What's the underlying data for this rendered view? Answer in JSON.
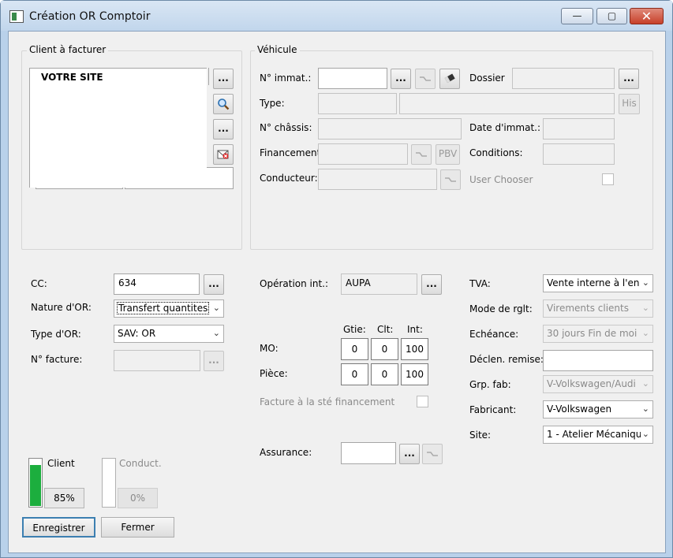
{
  "window": {
    "title": "Création OR Comptoir",
    "minimize": "—",
    "maximize": "▢",
    "close": "✕"
  },
  "client_group": {
    "legend": "Client à facturer",
    "name": "VOTRE SITE",
    "btn_more": "...",
    "btn_more2": "..."
  },
  "vehicule_group": {
    "legend": "Véhicule",
    "immat_label": "N° immat.:",
    "immat_value": "",
    "immat_more": "...",
    "dossier_label": "Dossier",
    "dossier_more": "...",
    "type_label": "Type:",
    "his_label": "His",
    "chassis_label": "N° châssis:",
    "date_immat_label": "Date d'immat.:",
    "financement_label": "Financement",
    "pbv_label": "PBV",
    "conditions_label": "Conditions:",
    "conducteur_label": "Conducteur:",
    "user_chooser_label": "User Chooser"
  },
  "left_form": {
    "cc_label": "CC:",
    "cc_value": "634",
    "cc_more": "...",
    "nature_label": "Nature d'OR:",
    "nature_value": "Transfert quantites",
    "type_label": "Type d'OR:",
    "type_value": "SAV: OR",
    "facture_label": "N° facture:",
    "facture_more": "..."
  },
  "middle_form": {
    "operation_label": "Opération int.:",
    "operation_value": "AUPA",
    "operation_more": "...",
    "col_gtie": "Gtie:",
    "col_clt": "Clt:",
    "col_int": "Int:",
    "mo_label": "MO:",
    "mo_values": [
      "0",
      "0",
      "100"
    ],
    "piece_label": "Pièce:",
    "piece_values": [
      "0",
      "0",
      "100"
    ],
    "facture_fin_label": "Facture à la sté financement",
    "assurance_label": "Assurance:",
    "assurance_more": "..."
  },
  "right_form": {
    "tva_label": "TVA:",
    "tva_value": "Vente interne à l'en",
    "mode_label": "Mode de rglt:",
    "mode_value": "Virements clients",
    "echeance_label": "Echéance:",
    "echeance_value": "30 jours Fin de moi",
    "declen_label": "Déclen. remise:",
    "grp_label": "Grp. fab:",
    "grp_value": "V-Volkswagen/Audi",
    "fabricant_label": "Fabricant:",
    "fabricant_value": "V-Volkswagen",
    "site_label": "Site:",
    "site_value": "1 - Atelier Mécaniqu"
  },
  "gauges": {
    "client_label": "Client",
    "client_pct": "85%",
    "client_level": 0.85,
    "conduct_label": "Conduct.",
    "conduct_pct": "0%",
    "conduct_level": 0
  },
  "footer": {
    "save_label": "Enregistrer",
    "close_label": "Fermer"
  },
  "colors": {
    "gauge_fill": "#1cae3e",
    "titlebar": "#c9dcef",
    "close_button": "#c7402a"
  }
}
